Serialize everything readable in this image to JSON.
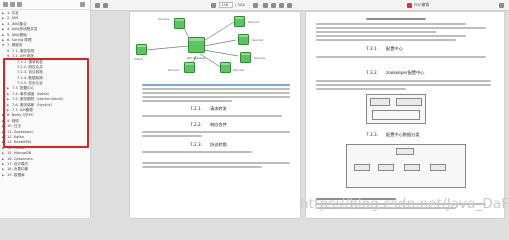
{
  "toolbar": {
    "page_input": "148",
    "page_total": "/ 308",
    "tab_label": "PDF编辑"
  },
  "sidebar": {
    "items": [
      {
        "level": 0,
        "arrow": "▶",
        "label": "1. 引言"
      },
      {
        "level": 0,
        "arrow": "▶",
        "label": "2. JVM"
      },
      {
        "level": 0,
        "arrow": "▶",
        "label": "3. JAVA集合"
      },
      {
        "level": 0,
        "arrow": "▶",
        "label": "4. JAVA多线程并发"
      },
      {
        "level": 0,
        "arrow": "▶",
        "label": "5. JAVA基础"
      },
      {
        "level": 0,
        "arrow": "▶",
        "label": "6. Spring 原理"
      },
      {
        "level": 0,
        "arrow": "▼",
        "label": "7. 微服务"
      },
      {
        "level": 1,
        "arrow": "▼",
        "label": "7.1. 服务发现"
      },
      {
        "level": 1,
        "arrow": "▼",
        "label": "7.2. API 网关"
      },
      {
        "level": 2,
        "arrow": "",
        "label": "7.2.1. 请求转发"
      },
      {
        "level": 2,
        "arrow": "",
        "label": "7.2.2. 响应合并"
      },
      {
        "level": 2,
        "arrow": "",
        "label": "7.2.3. 协议转换"
      },
      {
        "level": 2,
        "arrow": "",
        "label": "7.2.4. 数据转换"
      },
      {
        "level": 2,
        "arrow": "",
        "label": "7.2.5. 安全认证"
      },
      {
        "level": 1,
        "arrow": "▶",
        "label": "7.3. 配置中心"
      },
      {
        "level": 1,
        "arrow": "▶",
        "label": "7.4. 事件调度（kafka）"
      },
      {
        "level": 1,
        "arrow": "▶",
        "label": "7.5. 服务跟踪（starter-sleuth）"
      },
      {
        "level": 1,
        "arrow": "▶",
        "label": "7.6. 服务熔断（Hystrix）"
      },
      {
        "level": 1,
        "arrow": "▶",
        "label": "7.7. API管理"
      },
      {
        "level": 0,
        "arrow": "▶",
        "label": "8. Netty 与RPC"
      },
      {
        "level": 0,
        "arrow": "▶",
        "label": "9. 网络"
      },
      {
        "level": 0,
        "arrow": "▶",
        "label": "10. 日志"
      },
      {
        "level": 0,
        "arrow": "▶",
        "label": "11. Zookeeper"
      },
      {
        "level": 0,
        "arrow": "▶",
        "label": "12. Kafka"
      },
      {
        "level": 0,
        "arrow": "▶",
        "label": "13. RabbitMQ"
      },
      {
        "level": 0,
        "arrow": "▶",
        "label": "14. Hbase"
      },
      {
        "level": 0,
        "arrow": "▶",
        "label": "15. MongoDB"
      },
      {
        "level": 0,
        "arrow": "▶",
        "label": "16. Cassandra"
      },
      {
        "level": 0,
        "arrow": "▶",
        "label": "17. 设计模式"
      },
      {
        "level": 0,
        "arrow": "▶",
        "label": "18. 负载均衡"
      },
      {
        "level": 0,
        "arrow": "▶",
        "label": "19. 数据库"
      }
    ]
  },
  "page_left": {
    "diagram_labels": [
      "Client",
      "API Gateway",
      "Service",
      "Service",
      "Service",
      "Service",
      "Service",
      "Service"
    ],
    "headings": [
      "7.2.1.",
      "请求转发",
      "7.2.2.",
      "响应合并",
      "7.2.3.",
      "协议转换"
    ]
  },
  "page_right": {
    "headings": [
      "7.3.1.",
      "配置中心",
      "7.3.2.",
      "zookeeper配置中心",
      "7.3.3.",
      "配置中心数据分类"
    ]
  },
  "watermark": "https://blog.csdn.net/Java_DaFei"
}
